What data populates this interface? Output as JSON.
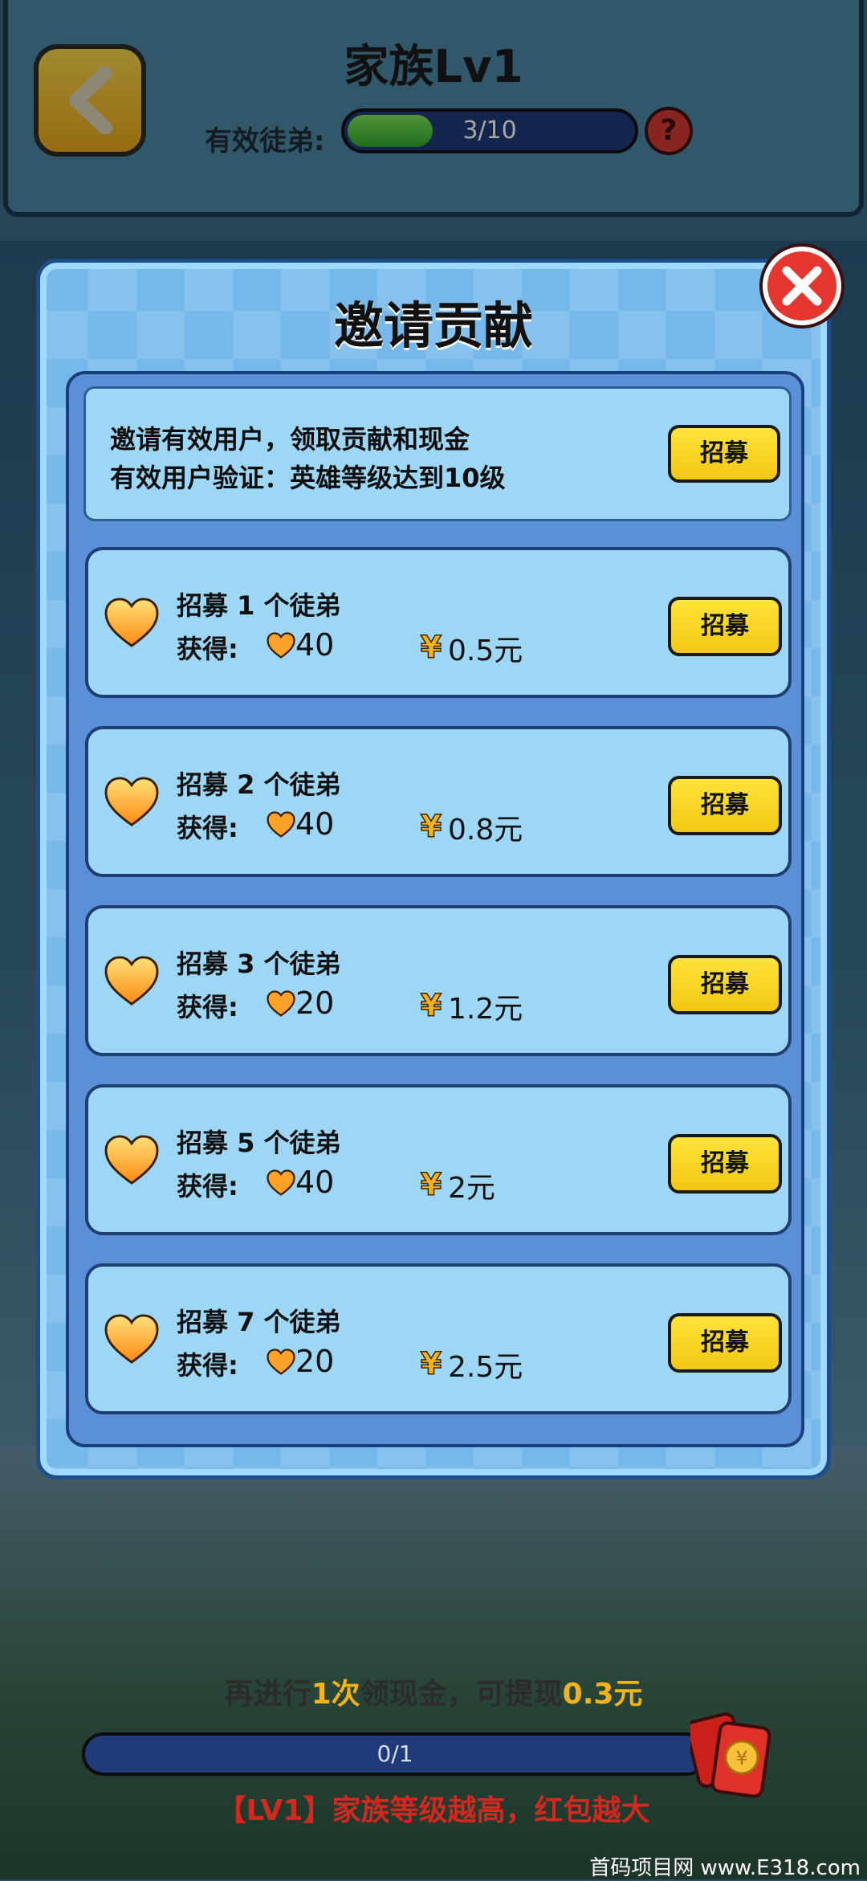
{
  "header": {
    "title": "家族Lv1",
    "progress_label": "有效徒弟:",
    "progress_text": "3/10",
    "progress_fraction": 0.3,
    "help_label": "?"
  },
  "dialog": {
    "title": "邀请贡献",
    "info": {
      "line1": "邀请有效用户，领取贡献和现金",
      "line2": "有效用户验证：英雄等级达到10级",
      "button": "招募"
    },
    "tasks": [
      {
        "title": "招募 1 个徒弟",
        "get_label": "获得:",
        "contribution": "40",
        "cash": "0.5元",
        "button": "招募"
      },
      {
        "title": "招募 2 个徒弟",
        "get_label": "获得:",
        "contribution": "40",
        "cash": "0.8元",
        "button": "招募"
      },
      {
        "title": "招募 3 个徒弟",
        "get_label": "获得:",
        "contribution": "20",
        "cash": "1.2元",
        "button": "招募"
      },
      {
        "title": "招募 5 个徒弟",
        "get_label": "获得:",
        "contribution": "40",
        "cash": "2元",
        "button": "招募"
      },
      {
        "title": "招募 7 个徒弟",
        "get_label": "获得:",
        "contribution": "20",
        "cash": "2.5元",
        "button": "招募"
      }
    ]
  },
  "bottom": {
    "prefix": "再进行",
    "count": "1次",
    "middle": "领现金，可提现",
    "amount": "0.3元",
    "progress_text": "0/1",
    "subtitle": "【LV1】家族等级越高，红包越大"
  },
  "watermark": "首码项目网 www.E318.com",
  "colors": {
    "button_yellow": "#f2c714",
    "close_red": "#e4352e",
    "highlight": "#f5b318",
    "subtitle_red": "#d2281f"
  }
}
